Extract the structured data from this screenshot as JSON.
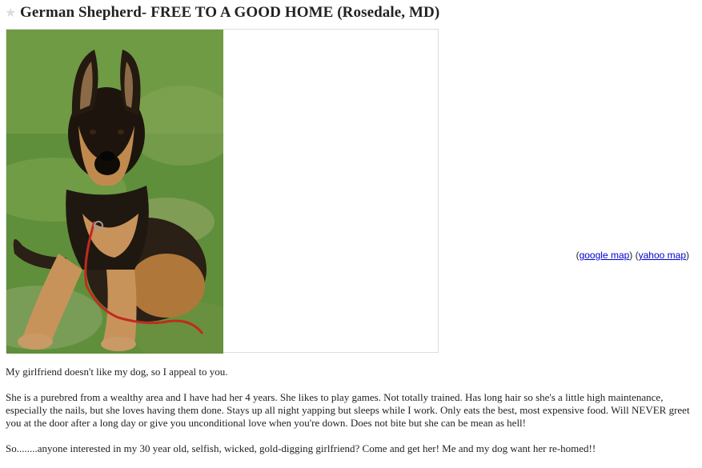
{
  "posting": {
    "title": "German Shepherd- FREE TO A GOOD HOME (Rosedale, MD)"
  },
  "icons": {
    "favorite": "star-icon"
  },
  "maps": {
    "open": "(",
    "google": "google map",
    "between": ") (",
    "yahoo": "yahoo map",
    "close": ")"
  },
  "body": {
    "p1": "My girlfriend doesn't like my dog, so I appeal to you.",
    "p2": "She is a purebred from a wealthy area and I have had her 4 years. She likes to play games. Not totally trained. Has long hair so she's a little high maintenance, especially the nails, but she loves having them done. Stays up all night yapping but sleeps while I work. Only eats the best, most expensive food. Will NEVER greet you at the door after a long day or give you unconditional love when you're down. Does not bite but she can be mean as hell!",
    "p3": "So........anyone interested in my 30 year old, selfish, wicked, gold-digging girlfriend? Come and get her! Me and my dog want her re-homed!!"
  }
}
